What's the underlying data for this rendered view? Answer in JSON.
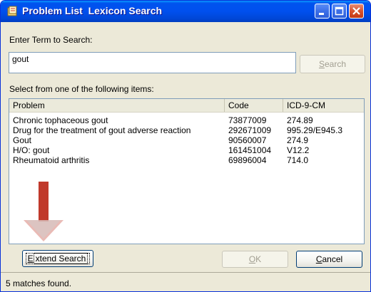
{
  "window": {
    "title": "Problem List  Lexicon Search"
  },
  "search": {
    "label": "Enter Term to Search:",
    "value": "gout",
    "button_label": "Search",
    "button_accel": "S",
    "button_rest": "earch"
  },
  "results": {
    "label": "Select from one of the following items:",
    "columns": [
      "Problem",
      "Code",
      "ICD-9-CM"
    ],
    "rows": [
      {
        "problem": "Chronic tophaceous gout",
        "code": "73877009",
        "icd": "274.89"
      },
      {
        "problem": "Drug for the treatment of gout adverse reaction",
        "code": "292671009",
        "icd": "995.29/E945.3"
      },
      {
        "problem": "Gout",
        "code": "90560007",
        "icd": "274.9"
      },
      {
        "problem": "H/O: gout",
        "code": "161451004",
        "icd": "V12.2"
      },
      {
        "problem": "Rheumatoid arthritis",
        "code": "69896004",
        "icd": "714.0"
      }
    ]
  },
  "buttons": {
    "extend_accel": "E",
    "extend_rest": "xtend Search",
    "ok_accel": "O",
    "ok_rest": "K",
    "cancel_accel": "C",
    "cancel_rest": "ancel"
  },
  "status": {
    "text": "5 matches found."
  },
  "colors": {
    "titlebar": "#0050ee",
    "window_bg": "#ece9d8",
    "arrow": "#c0392b"
  },
  "icons": [
    "app-icon",
    "minimize-icon",
    "maximize-icon",
    "close-icon",
    "down-arrow-icon"
  ]
}
